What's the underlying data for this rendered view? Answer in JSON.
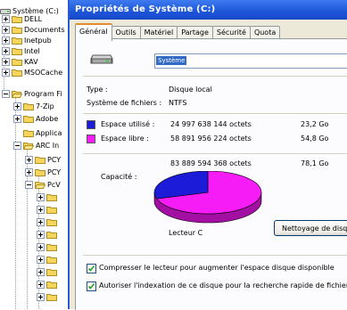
{
  "tree": {
    "root_label": "Système (C:)",
    "items": [
      {
        "label": "DELL"
      },
      {
        "label": "Documents"
      },
      {
        "label": "Inetpub"
      },
      {
        "label": "Intel"
      },
      {
        "label": "KAV"
      },
      {
        "label": "MSOCache"
      },
      {
        "label": "Program Fi"
      },
      {
        "label": "7-Zip"
      },
      {
        "label": "Adobe"
      },
      {
        "label": "Applica"
      },
      {
        "label": "ARC In"
      },
      {
        "label": "PCY"
      },
      {
        "label": "PCY"
      },
      {
        "label": "PcV"
      }
    ]
  },
  "dialog": {
    "title": "Propriétés de Système (C:)",
    "tabs": [
      {
        "label": "Général",
        "active": true
      },
      {
        "label": "Outils"
      },
      {
        "label": "Matériel"
      },
      {
        "label": "Partage"
      },
      {
        "label": "Sécurité"
      },
      {
        "label": "Quota"
      }
    ],
    "name_value": "Système",
    "type_label": "Type :",
    "type_value": "Disque local",
    "fs_label": "Système de fichiers :",
    "fs_value": "NTFS",
    "used": {
      "label": "Espace utilisé :",
      "bytes": "24 997 638 144 octets",
      "size": "23,2 Go",
      "color": "#1c1cd8"
    },
    "free": {
      "label": "Espace libre :",
      "bytes": "58 891 956 224 octets",
      "size": "54,8 Go",
      "color": "#f51cf5"
    },
    "capacity": {
      "label": "Capacité :",
      "bytes": "83 889 594 368 octets",
      "size": "78,1 Go"
    },
    "used_fraction": 0.298,
    "drive_label": "Lecteur C",
    "cleanup_label": "Nettoyage de disque",
    "compress_label": "Compresser le lecteur pour augmenter l'espace disque disponible",
    "compress_checked": true,
    "index_label": "Autoriser l'indexation de ce disque pour la recherche rapide de fichiers",
    "index_checked": true
  }
}
